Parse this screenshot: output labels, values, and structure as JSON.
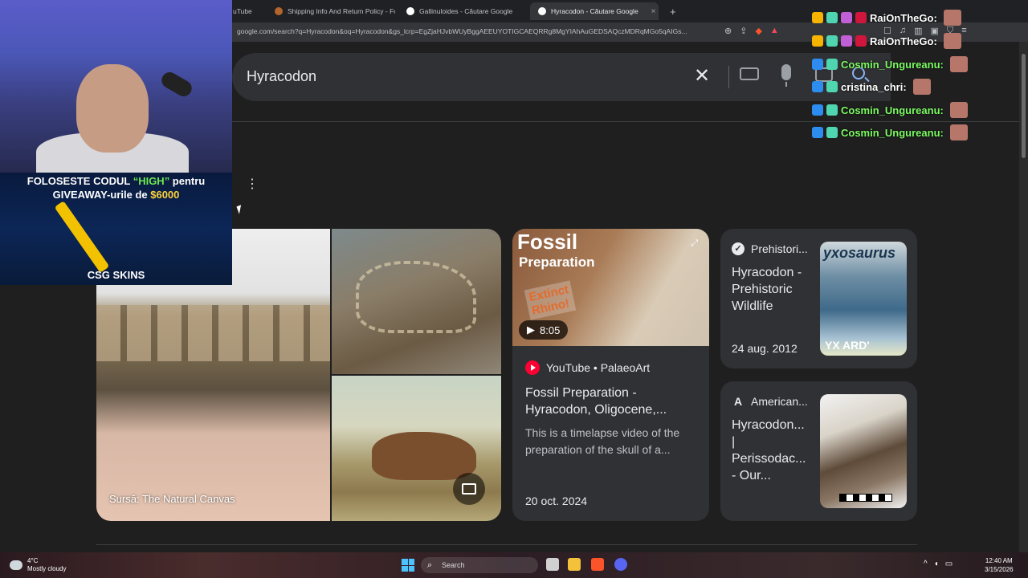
{
  "browser": {
    "tabs": [
      {
        "label": "uTube",
        "active": false
      },
      {
        "label": "Shipping Info And Return Policy - Fo",
        "active": false
      },
      {
        "label": "Gallinuloides - Căutare Google",
        "active": false
      },
      {
        "label": "Hyracodon - Căutare Google",
        "active": true
      }
    ],
    "new_tab": "+",
    "close_tab": "×",
    "url": "google.com/search?q=Hyracodon&oq=Hyracodon&gs_lcrp=EgZjaHJvbWUyBggAEEUYOTIGCAEQRRg8MgYIAhAuGEDSAQczMDRqMGo5qAIGs..."
  },
  "search": {
    "query": "Hyracodon",
    "clear_label": "✕"
  },
  "images": {
    "source_caption": "Sursă: The Natural Canvas"
  },
  "video_card": {
    "thumb_title": "Fossil",
    "thumb_subtitle": "Preparation",
    "thumb_badge_line1": "Extinct",
    "thumb_badge_line2": "Rhino!",
    "duration": "8:05",
    "source": "YouTube • PalaeoArt",
    "title": "Fossil Preparation - Hyracodon, Oligocene,...",
    "description": "This is a timelapse video of the preparation of the skull of a...",
    "date": "20 oct. 2024"
  },
  "cards": {
    "prehistoric": {
      "source": "Prehistori...",
      "title": "Hyracodon - Prehistoric Wildlife",
      "date": "24 aug. 2012",
      "thumb_text_top": "yxosaurus",
      "thumb_text_bottom": "YX ARD'"
    },
    "american": {
      "source": "American...",
      "source_icon_letter": "A",
      "title": "Hyracodon... | Perissodac... - Our..."
    }
  },
  "overlay": {
    "promo_line1_a": "FOLOSESTE CODUL ",
    "promo_code": "“HIGH”",
    "promo_line1_b": " pentru",
    "promo_line2_a": "GIVEAWAY-urile de ",
    "promo_amount": "$6000",
    "brand": "CSG SKINS",
    "chat": [
      {
        "name": "RaiOnTheGo:",
        "color": "white"
      },
      {
        "name": "RaiOnTheGo:",
        "color": "white"
      },
      {
        "name": "Cosmin_Ungureanu:",
        "color": "green"
      },
      {
        "name": "cristina_chri:",
        "color": "white"
      },
      {
        "name": "Cosmin_Ungureanu:",
        "color": "green"
      },
      {
        "name": "Cosmin_Ungureanu:",
        "color": "green"
      }
    ]
  },
  "taskbar": {
    "temperature": "4°C",
    "weather": "Mostly cloudy",
    "search_placeholder": "Search",
    "time": "12:40 AM",
    "date": "3/15/2026"
  },
  "colors": {
    "background": "#1f1f1f",
    "card": "#303134",
    "chat_green": "#7dfc63",
    "promo_green": "#6eea55",
    "promo_yellow": "#ffd23c",
    "youtube_red": "#ff0033"
  }
}
